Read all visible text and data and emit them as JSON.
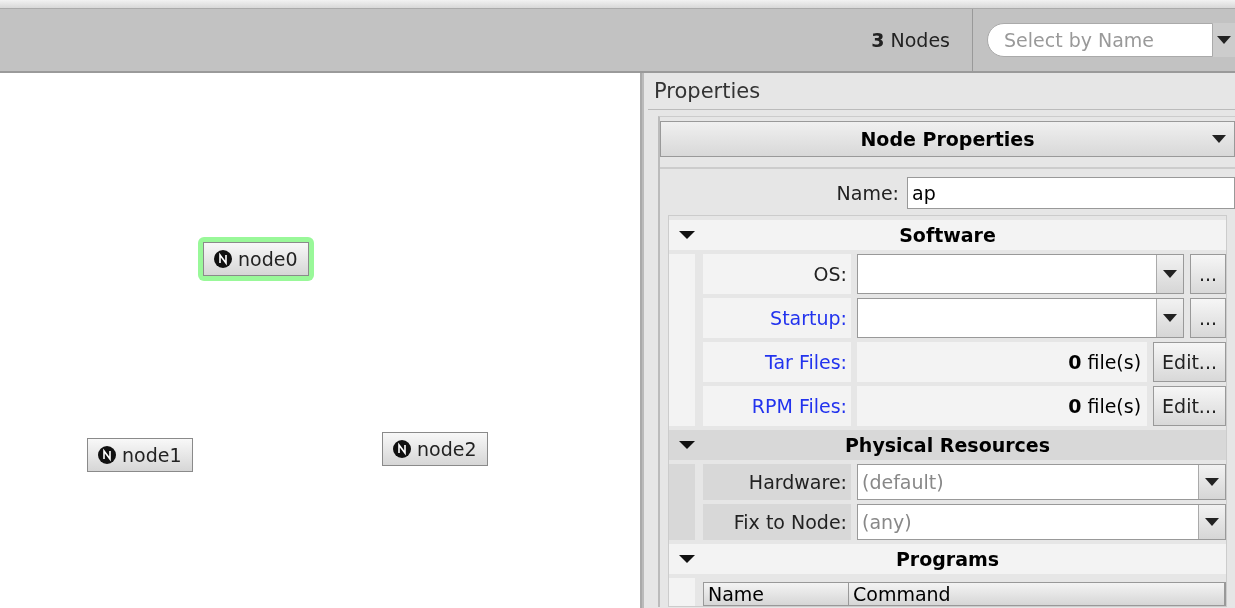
{
  "toolbar": {
    "node_count": "**3** Nodes",
    "select_by_name": {
      "placeholder": "Select by Name"
    }
  },
  "canvas": {
    "nodes": [
      {
        "label": "node0",
        "selected": true
      },
      {
        "label": "node1",
        "selected": false
      },
      {
        "label": "node2",
        "selected": false
      }
    ]
  },
  "properties": {
    "title": "Properties",
    "panel_selector": "Node Properties",
    "name_label": "Name:",
    "name_value": "ap",
    "sections": [
      {
        "title": "Software",
        "expanded": true,
        "rows": [
          {
            "kind": "combo",
            "label": "OS:",
            "link": false,
            "button": "..."
          },
          {
            "kind": "combo",
            "label": "Startup:",
            "link": true,
            "button": "..."
          },
          {
            "kind": "files",
            "label": "Tar Files:",
            "link": true,
            "count": "**0** file(s)",
            "button": "Edit..."
          },
          {
            "kind": "files",
            "label": "RPM Files:",
            "link": true,
            "count": "**0** file(s)",
            "button": "Edit..."
          }
        ]
      },
      {
        "title": "Physical Resources",
        "expanded": true,
        "rows": [
          {
            "kind": "select",
            "label": "Hardware:",
            "link": false,
            "value": "(default)"
          },
          {
            "kind": "select",
            "label": "Fix to Node:",
            "link": false,
            "value": "(any)"
          }
        ]
      },
      {
        "title": "Programs",
        "expanded": true,
        "rows": [
          {
            "kind": "table",
            "columns": [
              "Name",
              "Command"
            ]
          }
        ]
      }
    ]
  }
}
